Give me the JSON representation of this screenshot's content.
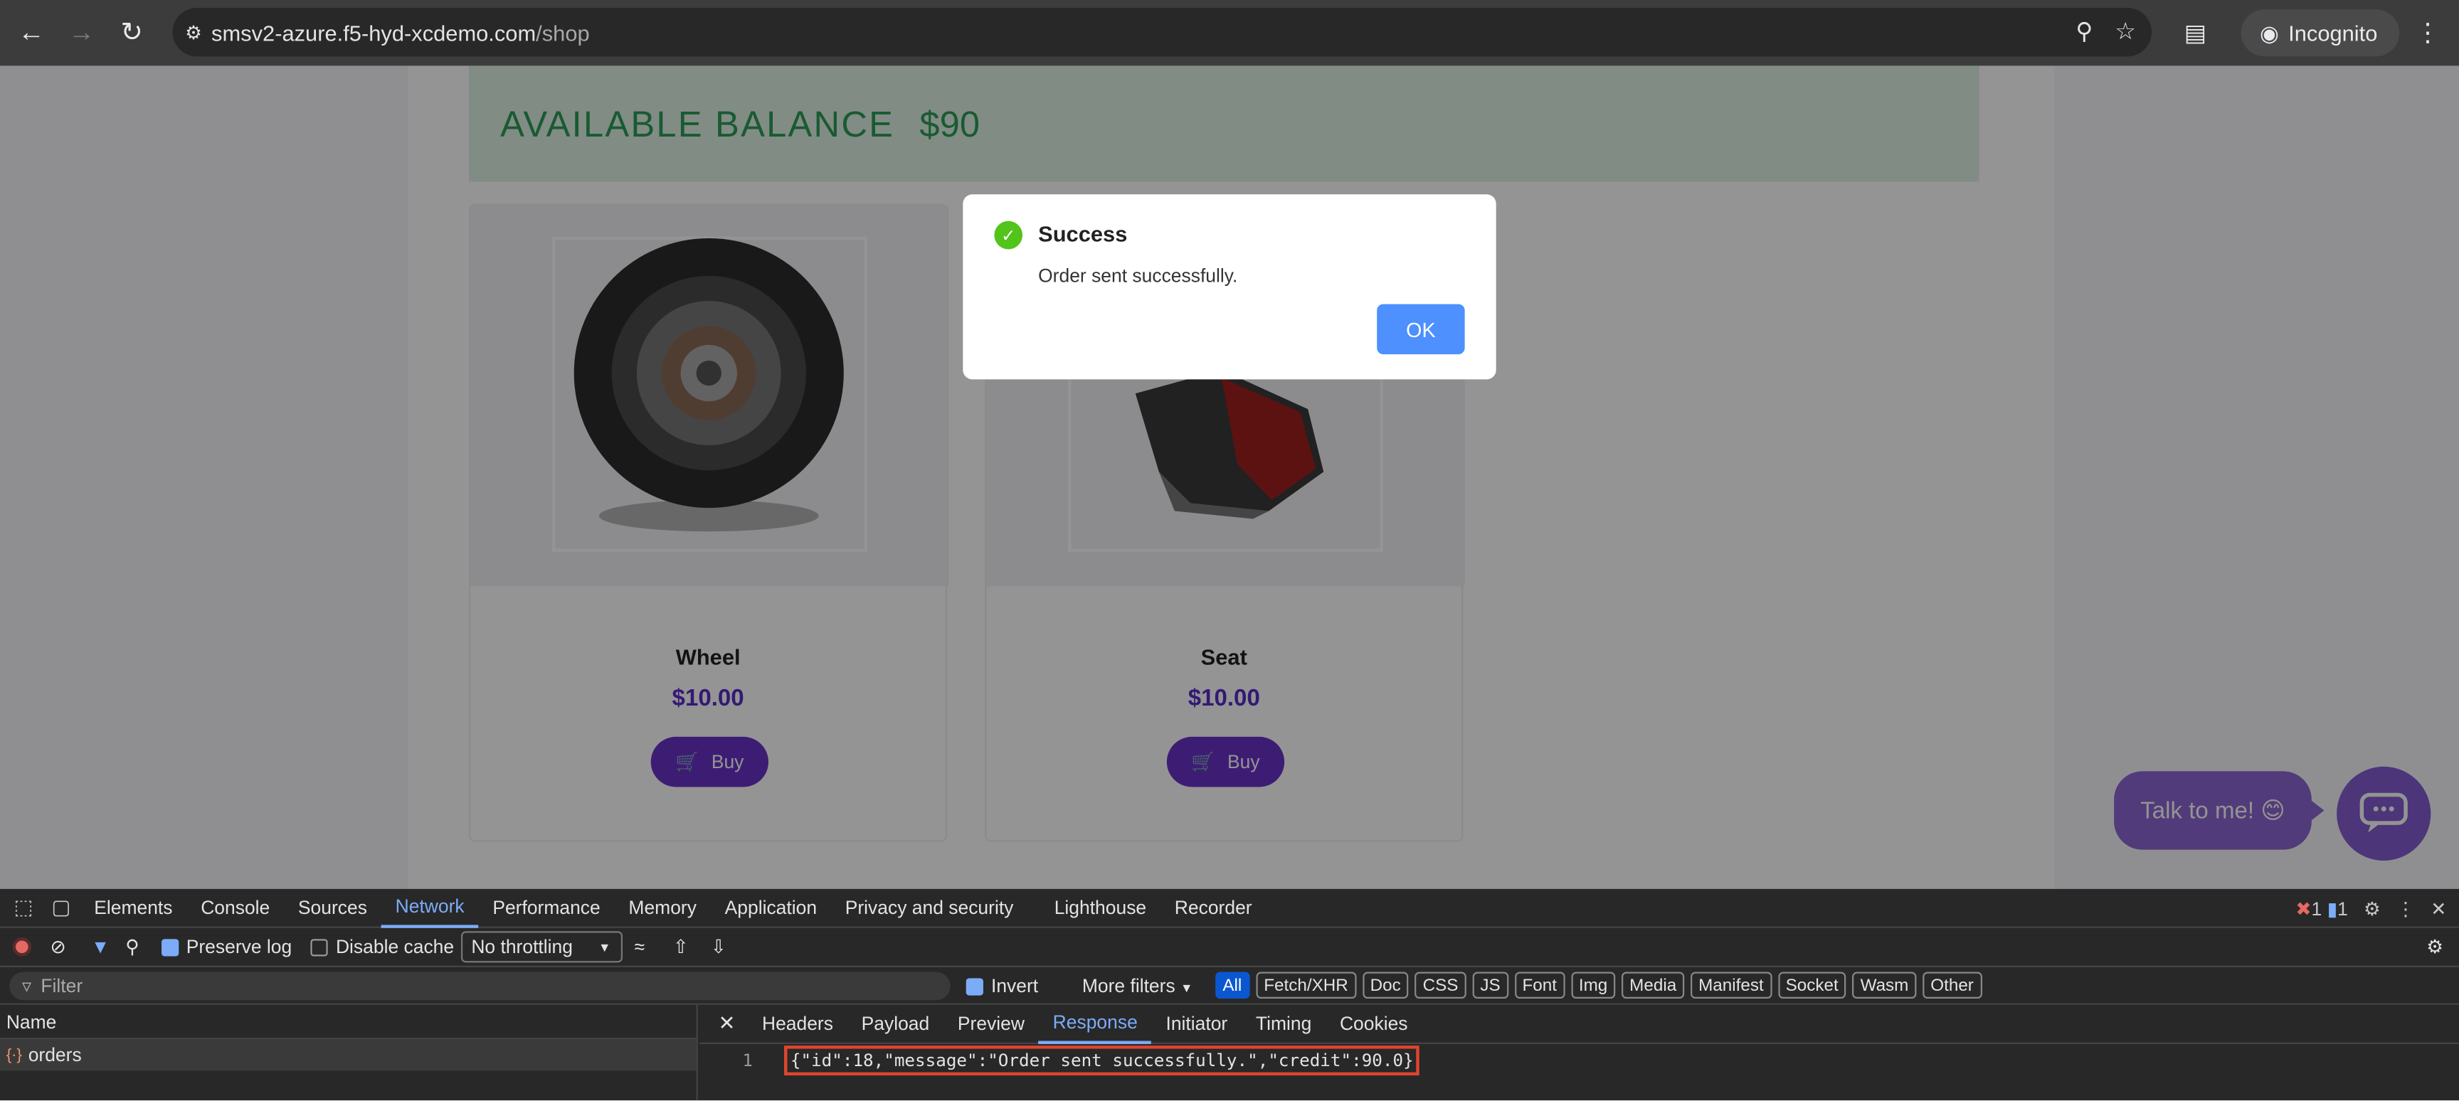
{
  "browser": {
    "url_host": "smsv2-azure.f5-hyd-xcdemo.com",
    "url_path": "/shop",
    "incognito_label": "Incognito"
  },
  "shop": {
    "balance_label": "AVAILABLE BALANCE",
    "balance_amount": "$90",
    "products": [
      {
        "name": "Wheel",
        "price": "$10.00",
        "buy_label": "Buy"
      },
      {
        "name": "Seat",
        "price": "$10.00",
        "buy_label": "Buy"
      }
    ],
    "talk_label": "Talk to me! 😊"
  },
  "dialog": {
    "title": "Success",
    "message": "Order sent successfully.",
    "ok_label": "OK"
  },
  "devtools": {
    "tabs": [
      "Elements",
      "Console",
      "Sources",
      "Network",
      "Performance",
      "Memory",
      "Application",
      "Privacy and security",
      "Lighthouse",
      "Recorder"
    ],
    "active_tab": "Network",
    "error_count": "1",
    "message_count": "1",
    "preserve_log_label": "Preserve log",
    "disable_cache_label": "Disable cache",
    "throttling_value": "No throttling",
    "filter_placeholder": "Filter",
    "invert_label": "Invert",
    "more_filters_label": "More filters",
    "type_filters": [
      "All",
      "Fetch/XHR",
      "Doc",
      "CSS",
      "JS",
      "Font",
      "Img",
      "Media",
      "Manifest",
      "Socket",
      "Wasm",
      "Other"
    ],
    "name_header": "Name",
    "request_name": "orders",
    "detail_tabs": [
      "Headers",
      "Payload",
      "Preview",
      "Response",
      "Initiator",
      "Timing",
      "Cookies"
    ],
    "active_detail_tab": "Response",
    "line_number": "1",
    "response_body": "{\"id\":18,\"message\":\"Order sent successfully.\",\"credit\":90.0}"
  }
}
